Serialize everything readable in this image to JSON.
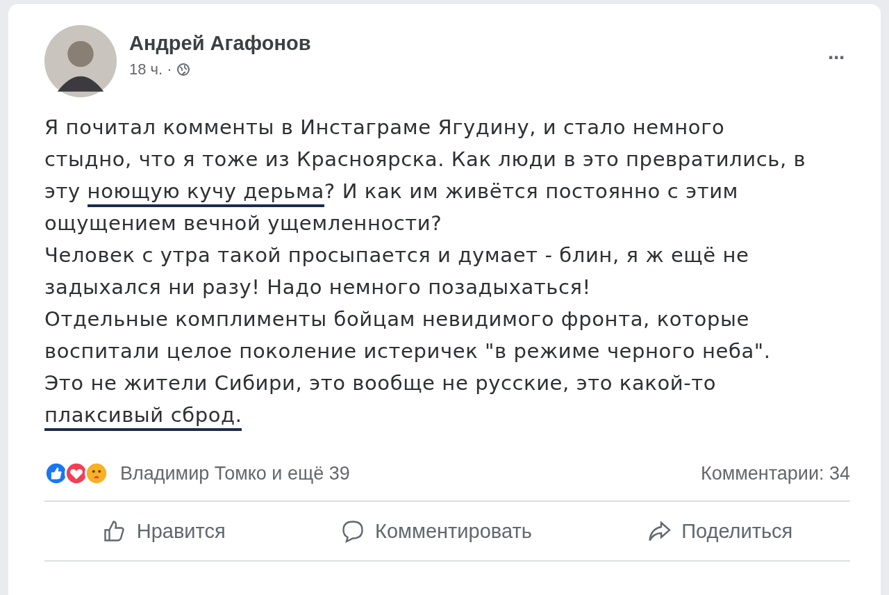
{
  "post": {
    "author": "Андрей Агафонов",
    "time": "18 ч. ·",
    "more": "···",
    "paragraphs": [
      [
        {
          "text": "Я почитал комменты в Инстаграме Ягудину, и стало немного стыдно, что я тоже из Красноярска. Как люди в это превратились, в эту ",
          "marked": false
        },
        {
          "text": "ноющую кучу дерьма",
          "marked": true
        },
        {
          "text": "? И как им живётся постоянно с этим ощущением вечной ущемленности?",
          "marked": false
        }
      ],
      [
        {
          "text": "Человек с утра такой просыпается и думает - блин, я ж ещё не задыхался ни разу! Надо немного позадыхаться!",
          "marked": false
        }
      ],
      [
        {
          "text": "Отдельные комплименты бойцам невидимого фронта, которые воспитали целое поколение истеричек \"в режиме черного неба\".",
          "marked": false
        }
      ],
      [
        {
          "text": "Это не жители Сибири, это вообще не русские, это какой-то ",
          "marked": false
        },
        {
          "text": "плаксивый сброд.",
          "marked": true
        }
      ]
    ],
    "reactions_text": "Владимир Томко и ещё 39",
    "comments_count": "Комментарии: 34",
    "actions": [
      {
        "kind": "like",
        "label": "Нравится"
      },
      {
        "kind": "comment",
        "label": "Комментировать"
      },
      {
        "kind": "share",
        "label": "Поделиться"
      }
    ]
  }
}
